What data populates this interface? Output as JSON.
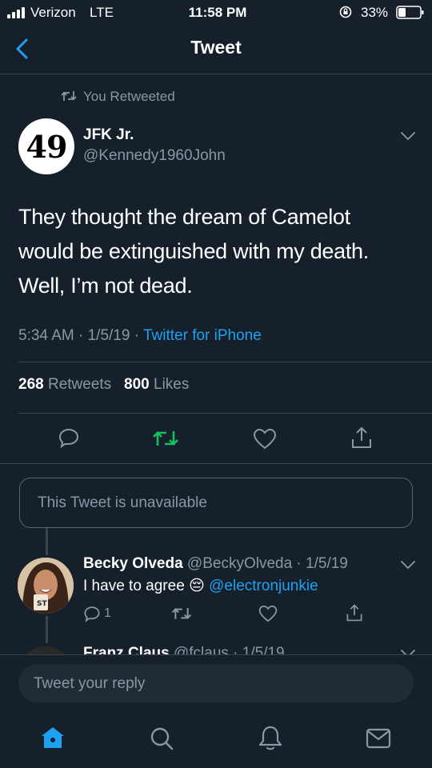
{
  "status_bar": {
    "carrier": "Verizon",
    "network": "LTE",
    "time": "11:58 PM",
    "battery": "33%"
  },
  "nav": {
    "title": "Tweet",
    "back_icon": "chevron-left-icon"
  },
  "retweet_context": "You Retweeted",
  "tweet": {
    "avatar_text": "49",
    "name": "JFK Jr.",
    "handle": "@Kennedy1960John",
    "text_line1": "They thought the dream of Camelot",
    "text_line2": "would be extinguished with my death.",
    "text_line3": "Well, I’m not dead.",
    "timestamp": "5:34 AM · 1/5/19 · ",
    "source": "Twitter for iPhone",
    "retweet_count": "268",
    "retweet_label": "Retweets",
    "like_count": "800",
    "like_label": "Likes"
  },
  "unavailable_text": "This Tweet is unavailable",
  "reply": {
    "name": "Becky Olveda",
    "meta": "@BeckyOlveda · 1/5/19",
    "text": "I have to agree",
    "emoji": "😔",
    "mention": "@electronjunkie",
    "reply_count": "1"
  },
  "next_reply_partial": {
    "name": "Franz Claus",
    "meta": "@fclaus · 1/5/19"
  },
  "reply_placeholder": "Tweet your reply",
  "colors": {
    "background": "#15202b",
    "accent": "#1da1f2",
    "retweeted": "#17bf63",
    "muted": "#8899a6",
    "divider": "#38444d"
  }
}
